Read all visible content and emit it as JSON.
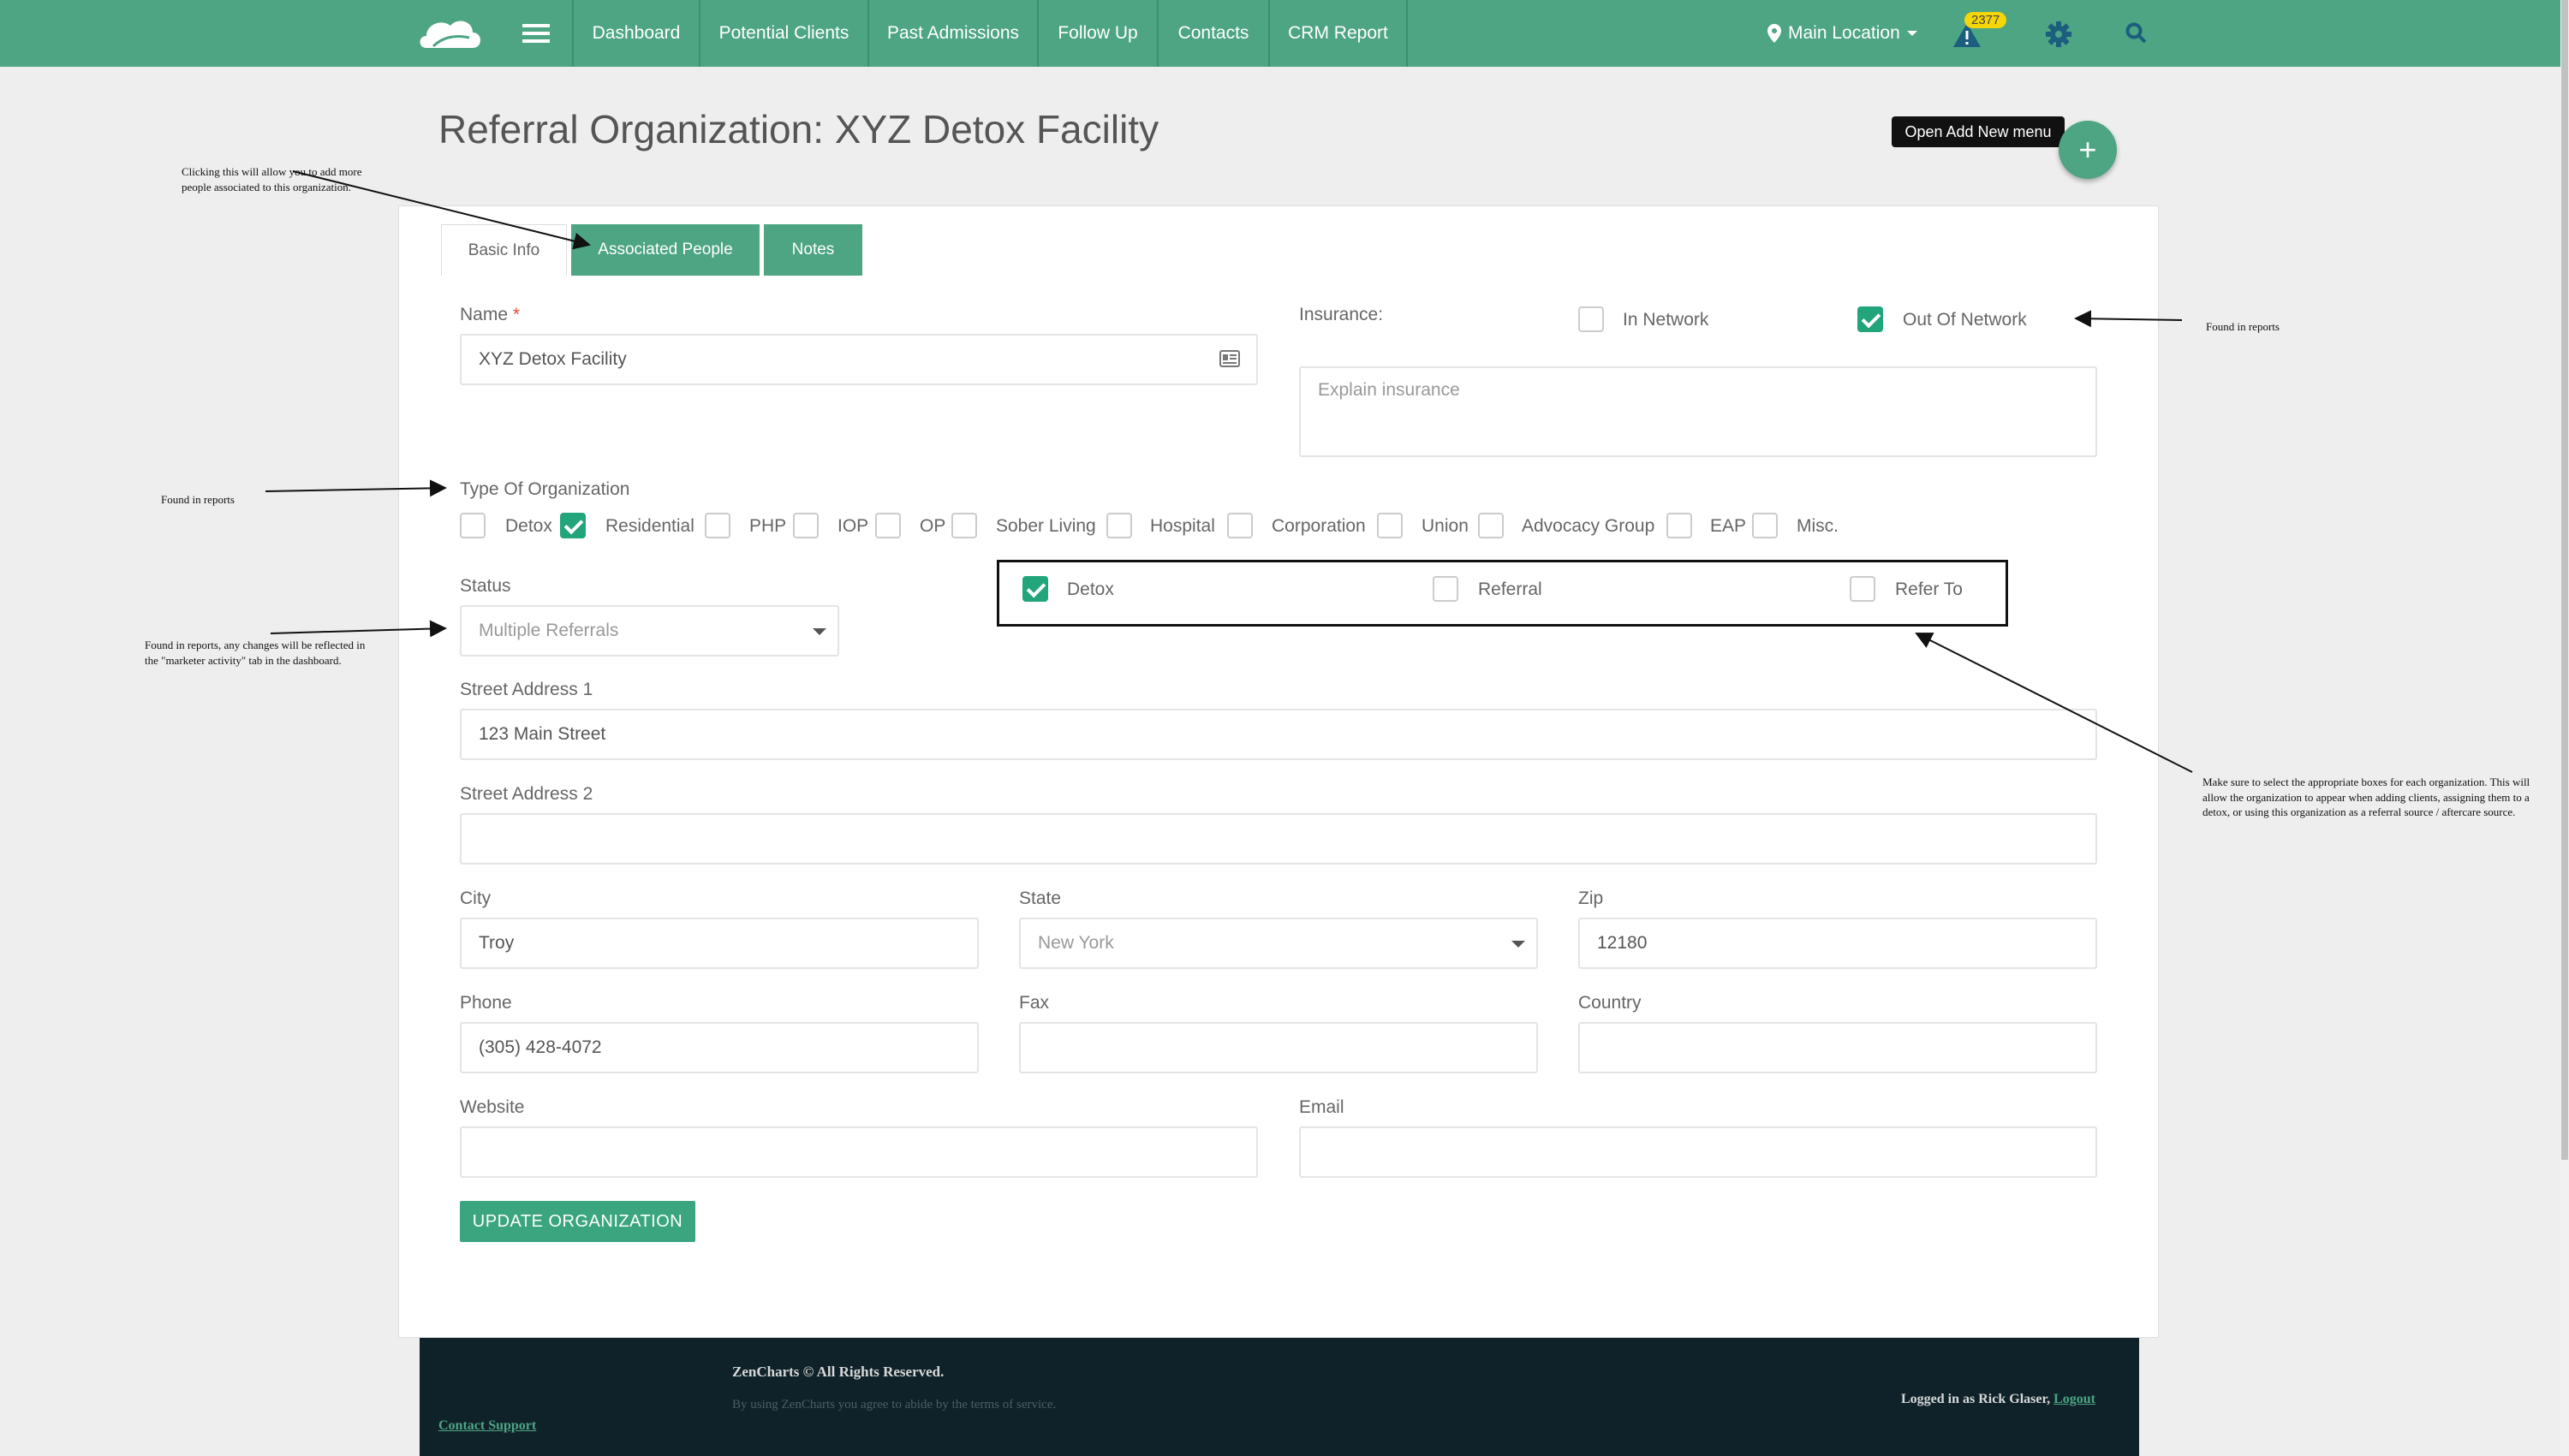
{
  "nav": {
    "items": [
      "Dashboard",
      "Potential Clients",
      "Past Admissions",
      "Follow Up",
      "Contacts",
      "CRM Report"
    ],
    "location": "Main Location",
    "alert_count": "2377"
  },
  "page": {
    "title": "Referral Organization: XYZ Detox Facility",
    "tooltip": "Open Add New menu",
    "add_symbol": "+"
  },
  "tabs": [
    "Basic Info",
    "Associated People",
    "Notes"
  ],
  "form": {
    "name_label": "Name",
    "name_required": "*",
    "name_value": "XYZ Detox Facility",
    "insurance_label": "Insurance:",
    "in_network_label": "In Network",
    "in_network_checked": false,
    "out_network_label": "Out Of Network",
    "out_network_checked": true,
    "insurance_placeholder": "Explain insurance",
    "type_label": "Type Of Organization",
    "types": [
      {
        "label": "Detox",
        "checked": false
      },
      {
        "label": "Residential",
        "checked": true
      },
      {
        "label": "PHP",
        "checked": false
      },
      {
        "label": "IOP",
        "checked": false
      },
      {
        "label": "OP",
        "checked": false
      },
      {
        "label": "Sober Living",
        "checked": false
      },
      {
        "label": "Hospital",
        "checked": false
      },
      {
        "label": "Corporation",
        "checked": false
      },
      {
        "label": "Union",
        "checked": false
      },
      {
        "label": "Advocacy Group",
        "checked": false
      },
      {
        "label": "EAP",
        "checked": false
      },
      {
        "label": "Misc.",
        "checked": false
      }
    ],
    "status_label": "Status",
    "status_value": "Multiple Referrals",
    "roles": [
      {
        "label": "Detox",
        "checked": true
      },
      {
        "label": "Referral",
        "checked": false
      },
      {
        "label": "Refer To",
        "checked": false
      }
    ],
    "street1_label": "Street Address 1",
    "street1_value": "123 Main Street",
    "street2_label": "Street Address 2",
    "street2_value": "",
    "city_label": "City",
    "city_value": "Troy",
    "state_label": "State",
    "state_value": "New York",
    "zip_label": "Zip",
    "zip_value": "12180",
    "phone_label": "Phone",
    "phone_value": "(305) 428-4072",
    "fax_label": "Fax",
    "country_label": "Country",
    "website_label": "Website",
    "email_label": "Email",
    "update_button": "UPDATE ORGANIZATION"
  },
  "footer": {
    "copyright": "ZenCharts © All Rights Reserved.",
    "terms": "By using ZenCharts you agree to abide by the terms of service.",
    "contact_support": "Contact Support",
    "logged_in_text": "Logged in as Rick Glaser,",
    "logout": "Logout"
  },
  "annotations": {
    "associated_people": "Clicking this will allow you to add more people associated to this organization.",
    "insurance": "Found in reports",
    "org_type": "Found in reports",
    "status": "Found in reports, any changes will be reflected in the \"marketer activity\" tab in the dashboard.",
    "roles": "Make sure to select the appropriate boxes for each organization. This will allow the organization to appear when adding clients, assigning them to a detox, or using this organization as a referral source / aftercare source."
  },
  "icons": {
    "logo": "cloud-logo",
    "menu": "hamburger-icon",
    "location": "map-pin-icon",
    "alert": "warning-icon",
    "settings": "gear-icon",
    "search": "search-icon",
    "name_field": "contact-card-icon"
  },
  "colors": {
    "nav": "#4da584",
    "accent": "#22a57b",
    "footer": "#0f2229",
    "badge": "#f5d60a"
  }
}
